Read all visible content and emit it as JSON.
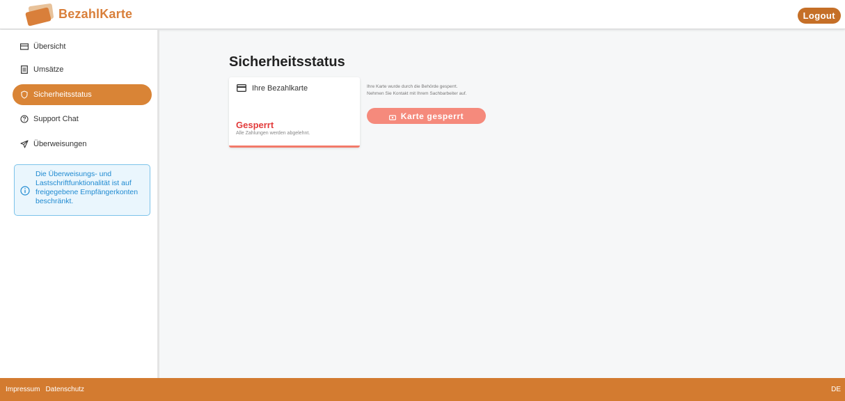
{
  "header": {
    "logo_text": "BezahlKarte",
    "logout_label": "Logout"
  },
  "sidebar": {
    "items": [
      {
        "label": "Übersicht",
        "icon": "card-icon"
      },
      {
        "label": "Umsätze",
        "icon": "list-icon"
      },
      {
        "label": "Sicherheitsstatus",
        "icon": "shield-icon",
        "active": true
      },
      {
        "label": "Support Chat",
        "icon": "question-icon"
      },
      {
        "label": "Überweisungen",
        "icon": "send-icon"
      }
    ],
    "info_text": "Die Überweisungs- und Lastschriftfunktionalität ist auf freigegebene Empfängerkonten beschränkt."
  },
  "main": {
    "title": "Sicherheitsstatus",
    "card": {
      "heading": "Ihre Bezahlkarte",
      "status": "Gesperrt",
      "status_sub": "Alle Zahlungen werden abgelehnt."
    },
    "notice_line1": "Ihre Karte wurde durch die Behörde gesperrt.",
    "notice_line2": "Nehmen Sie Kontakt mit Ihrem Sachbarbeiter auf.",
    "locked_button": "Karte gesperrt"
  },
  "footer": {
    "impressum": "Impressum",
    "datenschutz": "Datenschutz",
    "language": "DE"
  },
  "colors": {
    "brand": "#d97f3a",
    "footer": "#d37b30",
    "status_red": "#e23b3b",
    "locked_button": "#f58a7c",
    "info_blue": "#1f8ad1"
  }
}
